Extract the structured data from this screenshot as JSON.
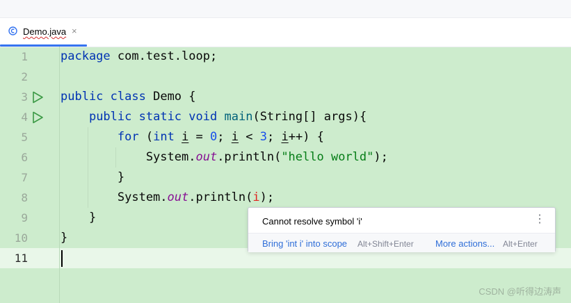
{
  "tab": {
    "filename": "Demo.java",
    "close_glyph": "×",
    "icon": "java-class-icon"
  },
  "lines": [
    {
      "number": "1",
      "tokens": [
        {
          "t": "package",
          "c": "kw"
        },
        {
          "t": " com.test.loop;",
          "c": ""
        }
      ]
    },
    {
      "number": "2",
      "tokens": []
    },
    {
      "number": "3",
      "run": true,
      "tokens": [
        {
          "t": "public",
          "c": "kw"
        },
        {
          "t": " ",
          "c": ""
        },
        {
          "t": "class",
          "c": "kw"
        },
        {
          "t": " Demo {",
          "c": ""
        }
      ]
    },
    {
      "number": "4",
      "run": true,
      "tokens": [
        {
          "t": "    ",
          "c": ""
        },
        {
          "t": "public",
          "c": "kw"
        },
        {
          "t": " ",
          "c": ""
        },
        {
          "t": "static",
          "c": "kw"
        },
        {
          "t": " ",
          "c": ""
        },
        {
          "t": "void",
          "c": "kw"
        },
        {
          "t": " ",
          "c": ""
        },
        {
          "t": "main",
          "c": "fn"
        },
        {
          "t": "(String[] args){",
          "c": ""
        }
      ]
    },
    {
      "number": "5",
      "tokens": [
        {
          "t": "        ",
          "c": ""
        },
        {
          "t": "for",
          "c": "kw"
        },
        {
          "t": " (",
          "c": ""
        },
        {
          "t": "int",
          "c": "kw"
        },
        {
          "t": " ",
          "c": ""
        },
        {
          "t": "i",
          "c": "uvar"
        },
        {
          "t": " = ",
          "c": ""
        },
        {
          "t": "0",
          "c": "num"
        },
        {
          "t": "; ",
          "c": ""
        },
        {
          "t": "i",
          "c": "uvar"
        },
        {
          "t": " < ",
          "c": ""
        },
        {
          "t": "3",
          "c": "num"
        },
        {
          "t": "; ",
          "c": ""
        },
        {
          "t": "i",
          "c": "uvar"
        },
        {
          "t": "++) {",
          "c": ""
        }
      ]
    },
    {
      "number": "6",
      "tokens": [
        {
          "t": "            System.",
          "c": ""
        },
        {
          "t": "out",
          "c": "fld"
        },
        {
          "t": ".println(",
          "c": ""
        },
        {
          "t": "\"hello world\"",
          "c": "str"
        },
        {
          "t": ");",
          "c": ""
        }
      ]
    },
    {
      "number": "7",
      "tokens": [
        {
          "t": "        }",
          "c": ""
        }
      ]
    },
    {
      "number": "8",
      "tokens": [
        {
          "t": "        System.",
          "c": ""
        },
        {
          "t": "out",
          "c": "fld"
        },
        {
          "t": ".println(",
          "c": ""
        },
        {
          "t": "i",
          "c": "err"
        },
        {
          "t": ");",
          "c": ""
        }
      ]
    },
    {
      "number": "9",
      "tokens": [
        {
          "t": "    }",
          "c": ""
        }
      ]
    },
    {
      "number": "10",
      "tokens": [
        {
          "t": "}",
          "c": ""
        }
      ]
    },
    {
      "number": "11",
      "current": true,
      "tokens": []
    }
  ],
  "popup": {
    "message": "Cannot resolve symbol 'i'",
    "more_icon": "⋮",
    "action1": "Bring 'int i' into scope",
    "shortcut1": "Alt+Shift+Enter",
    "action2": "More actions...",
    "shortcut2": "Alt+Enter"
  },
  "watermark": "CSDN @听得边涛声",
  "colors": {
    "editor_bg": "#cdeccd",
    "keyword": "#0033b3",
    "string": "#067d17",
    "error": "#e0231f",
    "field": "#871094",
    "accent": "#3574f0"
  }
}
